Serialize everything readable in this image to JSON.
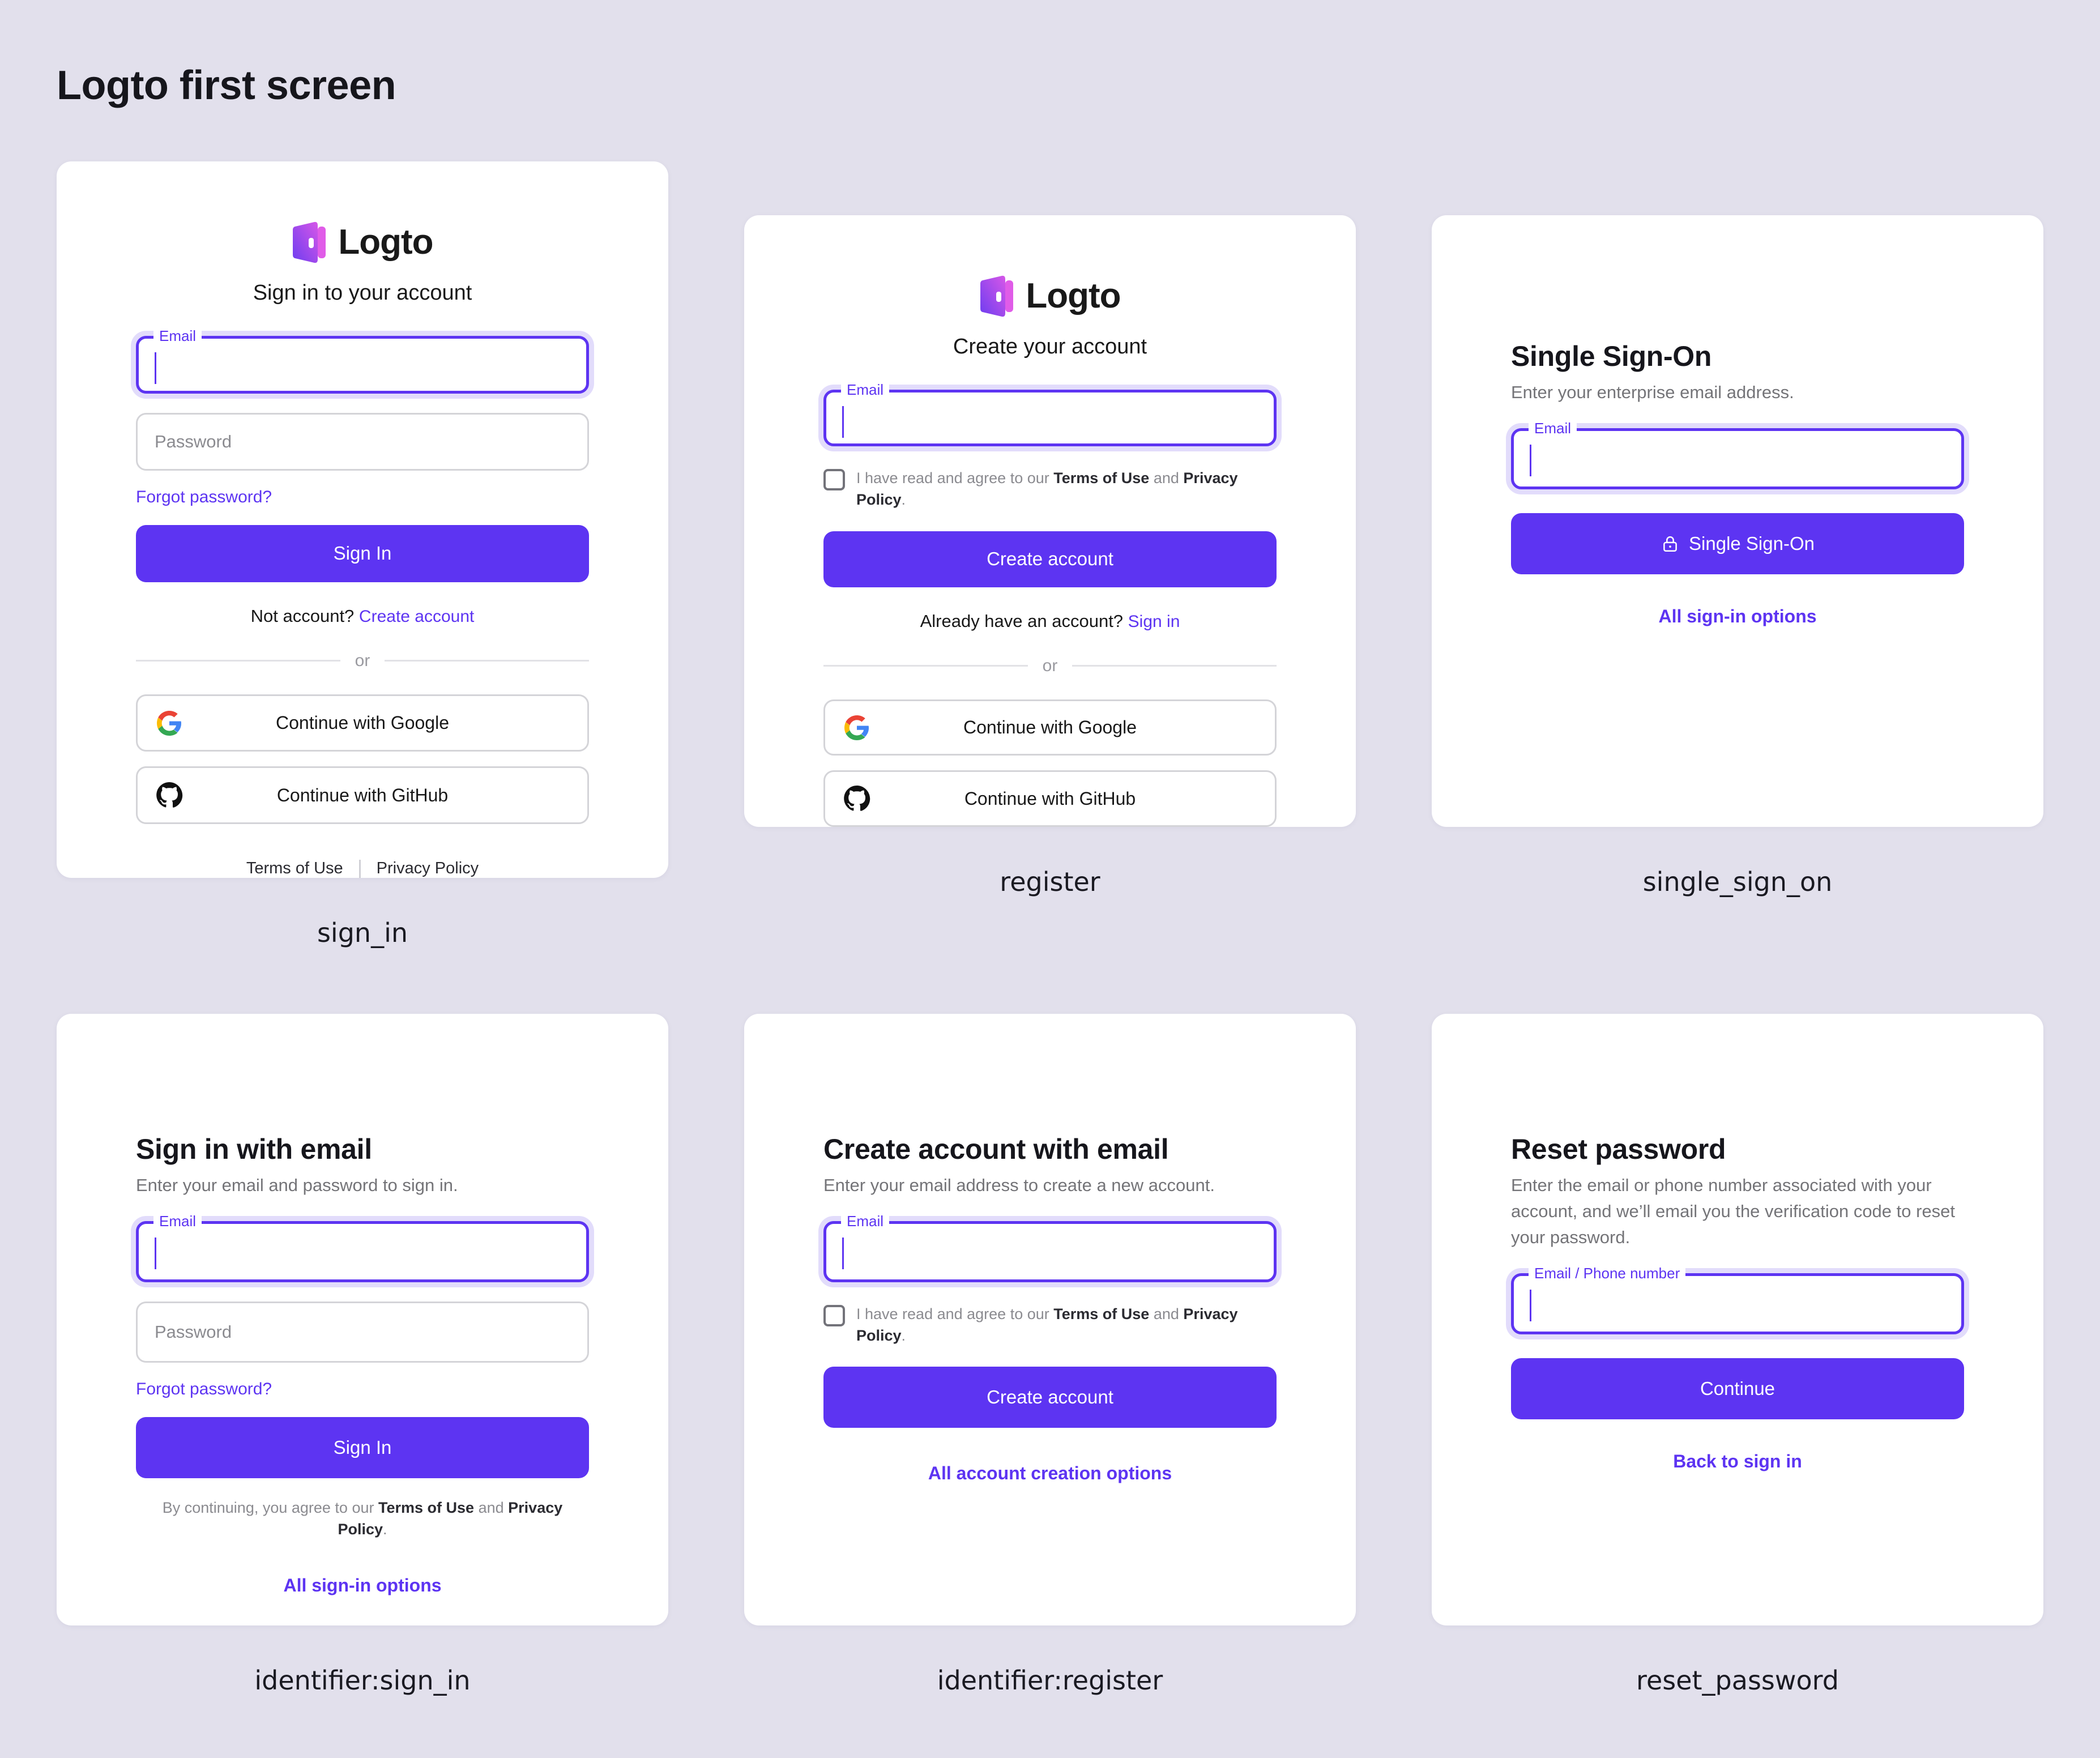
{
  "page": {
    "title": "Logto first screen",
    "background_color": "#e2e0ec",
    "accent_color": "#5d34f2",
    "card_background": "#ffffff"
  },
  "brand": {
    "name": "Logto",
    "logo_icon": "logto-door-logo",
    "gradient_from": "#7c3aed",
    "gradient_to": "#e05ce8"
  },
  "common": {
    "email_label": "Email",
    "password_placeholder": "Password",
    "or_label": "or",
    "google_label": "Continue with Google",
    "github_label": "Continue with GitHub",
    "terms_of_use": "Terms of Use",
    "privacy_policy": "Privacy Policy",
    "agree_prefix": "I have read and agree to our",
    "agree_joiner": "and",
    "agree_suffix": ".",
    "continuing_prefix": "By continuing, you agree to our",
    "continuing_joiner": "and",
    "continuing_suffix": "."
  },
  "cards": {
    "sign_in": {
      "caption": "sign_in",
      "title": "Sign in to your account",
      "email_label": "Email",
      "password_placeholder": "Password",
      "forgot_password": "Forgot password?",
      "submit_label": "Sign In",
      "switch_prompt": "Not account?",
      "switch_link": "Create account",
      "or_label": "or",
      "google_label": "Continue with Google",
      "github_label": "Continue with GitHub",
      "footer_terms": "Terms of Use",
      "footer_privacy": "Privacy Policy"
    },
    "register": {
      "caption": "register",
      "title": "Create your account",
      "email_label": "Email",
      "agree_prefix": "I have read and agree to our",
      "agree_terms": "Terms of Use",
      "agree_joiner": "and",
      "agree_privacy": "Privacy Policy",
      "agree_suffix": ".",
      "submit_label": "Create account",
      "switch_prompt": "Already have an account?",
      "switch_link": "Sign in",
      "or_label": "or",
      "google_label": "Continue with Google",
      "github_label": "Continue with GitHub"
    },
    "single_sign_on": {
      "caption": "single_sign_on",
      "heading": "Single Sign-On",
      "subheading": "Enter your enterprise email address.",
      "email_label": "Email",
      "submit_label": "Single Sign-On",
      "submit_icon": "lock-icon",
      "alt_link": "All sign-in options"
    },
    "identifier_sign_in": {
      "caption": "identifier:sign_in",
      "heading": "Sign in with email",
      "subheading": "Enter your email and password to sign in.",
      "email_label": "Email",
      "password_placeholder": "Password",
      "forgot_password": "Forgot password?",
      "submit_label": "Sign In",
      "terms_prefix": "By continuing, you agree to our",
      "terms_terms": "Terms of Use",
      "terms_joiner": "and",
      "terms_privacy": "Privacy Policy",
      "terms_suffix": ".",
      "alt_link": "All sign-in options"
    },
    "identifier_register": {
      "caption": "identifier:register",
      "heading": "Create account with email",
      "subheading": "Enter your email address to create a new account.",
      "email_label": "Email",
      "agree_prefix": "I have read and agree to our",
      "agree_terms": "Terms of Use",
      "agree_joiner": "and",
      "agree_privacy": "Privacy Policy",
      "agree_suffix": ".",
      "submit_label": "Create account",
      "alt_link": "All account creation options"
    },
    "reset_password": {
      "caption": "reset_password",
      "heading": "Reset password",
      "subheading": "Enter the email or phone number associated with your account, and we’ll email you the verification code to reset your password.",
      "identifier_label": "Email / Phone number",
      "submit_label": "Continue",
      "alt_link": "Back to sign in"
    }
  }
}
